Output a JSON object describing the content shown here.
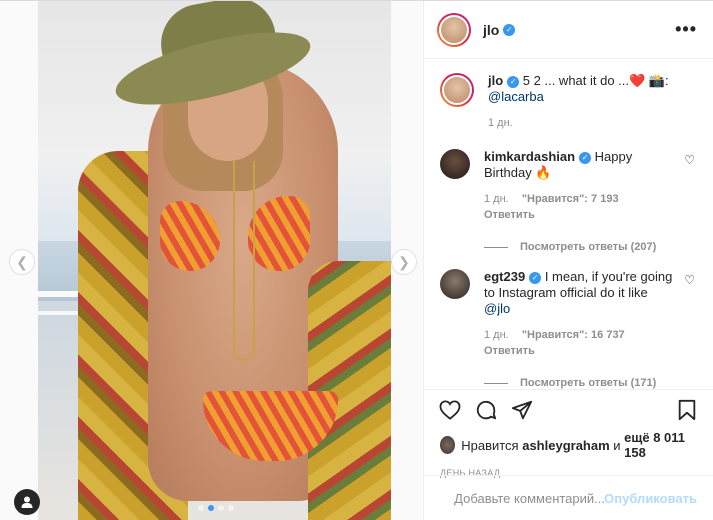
{
  "post": {
    "author": "jlo",
    "more_label": "•••",
    "caption_text": "5 2 ... what it do ...❤️ 📸:",
    "caption_mention": "@lacarba",
    "caption_time": "1 дн.",
    "carousel_dots": 4,
    "active_dot": 1
  },
  "comments": [
    {
      "user": "kimkardashian",
      "text": "Happy Birthday 🔥",
      "time": "1 дн.",
      "likes": "\"Нравится\": 7 193",
      "reply": "Ответить",
      "view_replies": "Посмотреть ответы (207)"
    },
    {
      "user": "egt239",
      "text": "I mean, if you're going to Instagram official do it like",
      "mention": "@jlo",
      "time": "1 дн.",
      "likes": "\"Нравится\": 16 737",
      "reply": "Ответить",
      "view_replies": "Посмотреть ответы (171)"
    }
  ],
  "likes_line": {
    "prefix": "Нравится",
    "user": "ashleygraham",
    "and": "и",
    "others": "ещё 8 011 158"
  },
  "date": "ДЕНЬ НАЗАД",
  "composer": {
    "placeholder": "Добавьте комментарий...",
    "post_label": "Опубликовать"
  },
  "colors": {
    "verified": "#3897f0",
    "link": "#00376b",
    "muted": "#8e8e8e",
    "post_disabled": "#b3dbff"
  },
  "icons": [
    "heart-icon",
    "comment-icon",
    "share-icon",
    "bookmark-icon",
    "emoji-icon",
    "user-tag-icon",
    "chevron-left-icon",
    "chevron-right-icon",
    "more-icon",
    "verified-icon"
  ]
}
